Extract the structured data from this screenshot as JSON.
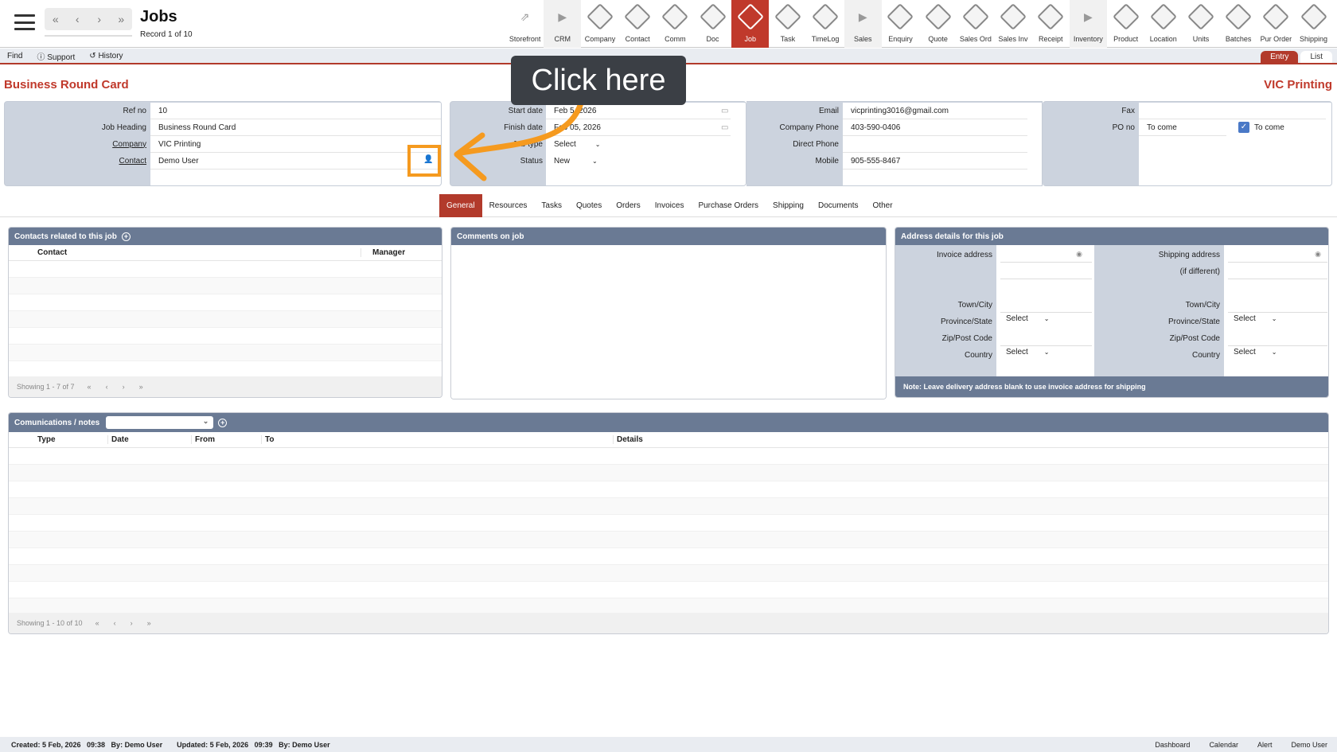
{
  "header": {
    "title": "Jobs",
    "record": "Record 1 of 10",
    "nav": {
      "first": "«",
      "prev": "‹",
      "next": "›",
      "last": "»"
    }
  },
  "modules": [
    {
      "label": "Storefront",
      "icon": "external-link-icon",
      "type": "plain",
      "glyph": "⇗"
    },
    {
      "label": "CRM",
      "icon": "arrow-right-icon",
      "type": "sep",
      "glyph": "▶"
    },
    {
      "label": "Company",
      "icon": "company-icon"
    },
    {
      "label": "Contact",
      "icon": "contact-icon"
    },
    {
      "label": "Comm",
      "icon": "comm-icon"
    },
    {
      "label": "Doc",
      "icon": "doc-icon"
    },
    {
      "label": "Job",
      "icon": "job-icon",
      "active": true
    },
    {
      "label": "Task",
      "icon": "task-icon"
    },
    {
      "label": "TimeLog",
      "icon": "timelog-icon"
    },
    {
      "label": "Sales",
      "icon": "arrow-right-icon",
      "type": "sep",
      "glyph": "▶"
    },
    {
      "label": "Enquiry",
      "icon": "enquiry-icon"
    },
    {
      "label": "Quote",
      "icon": "quote-icon"
    },
    {
      "label": "Sales Ord",
      "icon": "sales-order-icon"
    },
    {
      "label": "Sales Inv",
      "icon": "sales-invoice-icon"
    },
    {
      "label": "Receipt",
      "icon": "receipt-icon"
    },
    {
      "label": "Inventory",
      "icon": "arrow-right-icon",
      "type": "sep",
      "glyph": "▶"
    },
    {
      "label": "Product",
      "icon": "product-icon"
    },
    {
      "label": "Location",
      "icon": "location-icon"
    },
    {
      "label": "Units",
      "icon": "units-icon"
    },
    {
      "label": "Batches",
      "icon": "batches-icon"
    },
    {
      "label": "Pur Order",
      "icon": "purchase-order-icon"
    },
    {
      "label": "Shipping",
      "icon": "shipping-icon"
    }
  ],
  "subbar": {
    "find": "Find",
    "support": "Support",
    "history": "History",
    "entry": "Entry",
    "list": "List"
  },
  "job": {
    "name": "Business Round Card",
    "company_heading": "VIC Printing",
    "labels": {
      "ref": "Ref no",
      "heading": "Job Heading",
      "company": "Company",
      "contact": "Contact",
      "start": "Start date",
      "finish": "Finish date",
      "type": "Job type",
      "status": "Status",
      "email": "Email",
      "phone": "Company Phone",
      "direct": "Direct Phone",
      "mobile": "Mobile",
      "fax": "Fax",
      "po": "PO no"
    },
    "values": {
      "ref": "10",
      "heading": "Business Round Card",
      "company": "VIC Printing",
      "contact": "Demo User",
      "start": "Feb 5, 2026",
      "finish": "Feb 05, 2026",
      "type": "Select",
      "status": "New",
      "email": "vicprinting3016@gmail.com",
      "phone": "403-590-0406",
      "direct": "",
      "mobile": "905-555-8467",
      "fax": "",
      "po": "To come",
      "po_check": "To come"
    }
  },
  "tabs": [
    "General",
    "Resources",
    "Tasks",
    "Quotes",
    "Orders",
    "Invoices",
    "Purchase Orders",
    "Shipping",
    "Documents",
    "Other"
  ],
  "contacts_box": {
    "title": "Contacts related to this job",
    "col_contact": "Contact",
    "col_manager": "Manager",
    "showing": "Showing 1 - 7 of 7"
  },
  "comments_box": {
    "title": "Comments on job"
  },
  "address_box": {
    "title": "Address details for this job",
    "invoice": "Invoice address",
    "shipping": "Shipping address",
    "ifdiff": "(if different)",
    "town": "Town/City",
    "province": "Province/State",
    "zip": "Zip/Post Code",
    "country": "Country",
    "select": "Select",
    "note": "Note: Leave delivery address blank to use invoice address for shipping"
  },
  "comms_box": {
    "title": "Comunications / notes",
    "cols": [
      "Type",
      "Date",
      "From",
      "To",
      "Details"
    ],
    "showing": "Showing 1 - 10 of 10"
  },
  "pager": {
    "first": "«",
    "prev": "‹",
    "next": "›",
    "last": "»"
  },
  "footer": {
    "created": "Created: 5 Feb, 2026   09:38   By: Demo User",
    "updated": "Updated: 5 Feb, 2026   09:39   By: Demo User",
    "links": [
      "Dashboard",
      "Calendar",
      "Alert",
      "Demo User"
    ]
  },
  "callout": "Click here",
  "colors": {
    "accent": "#b23a2b",
    "panel": "#ccd3de",
    "header": "#6a7a94",
    "highlight": "#f59a1f"
  }
}
